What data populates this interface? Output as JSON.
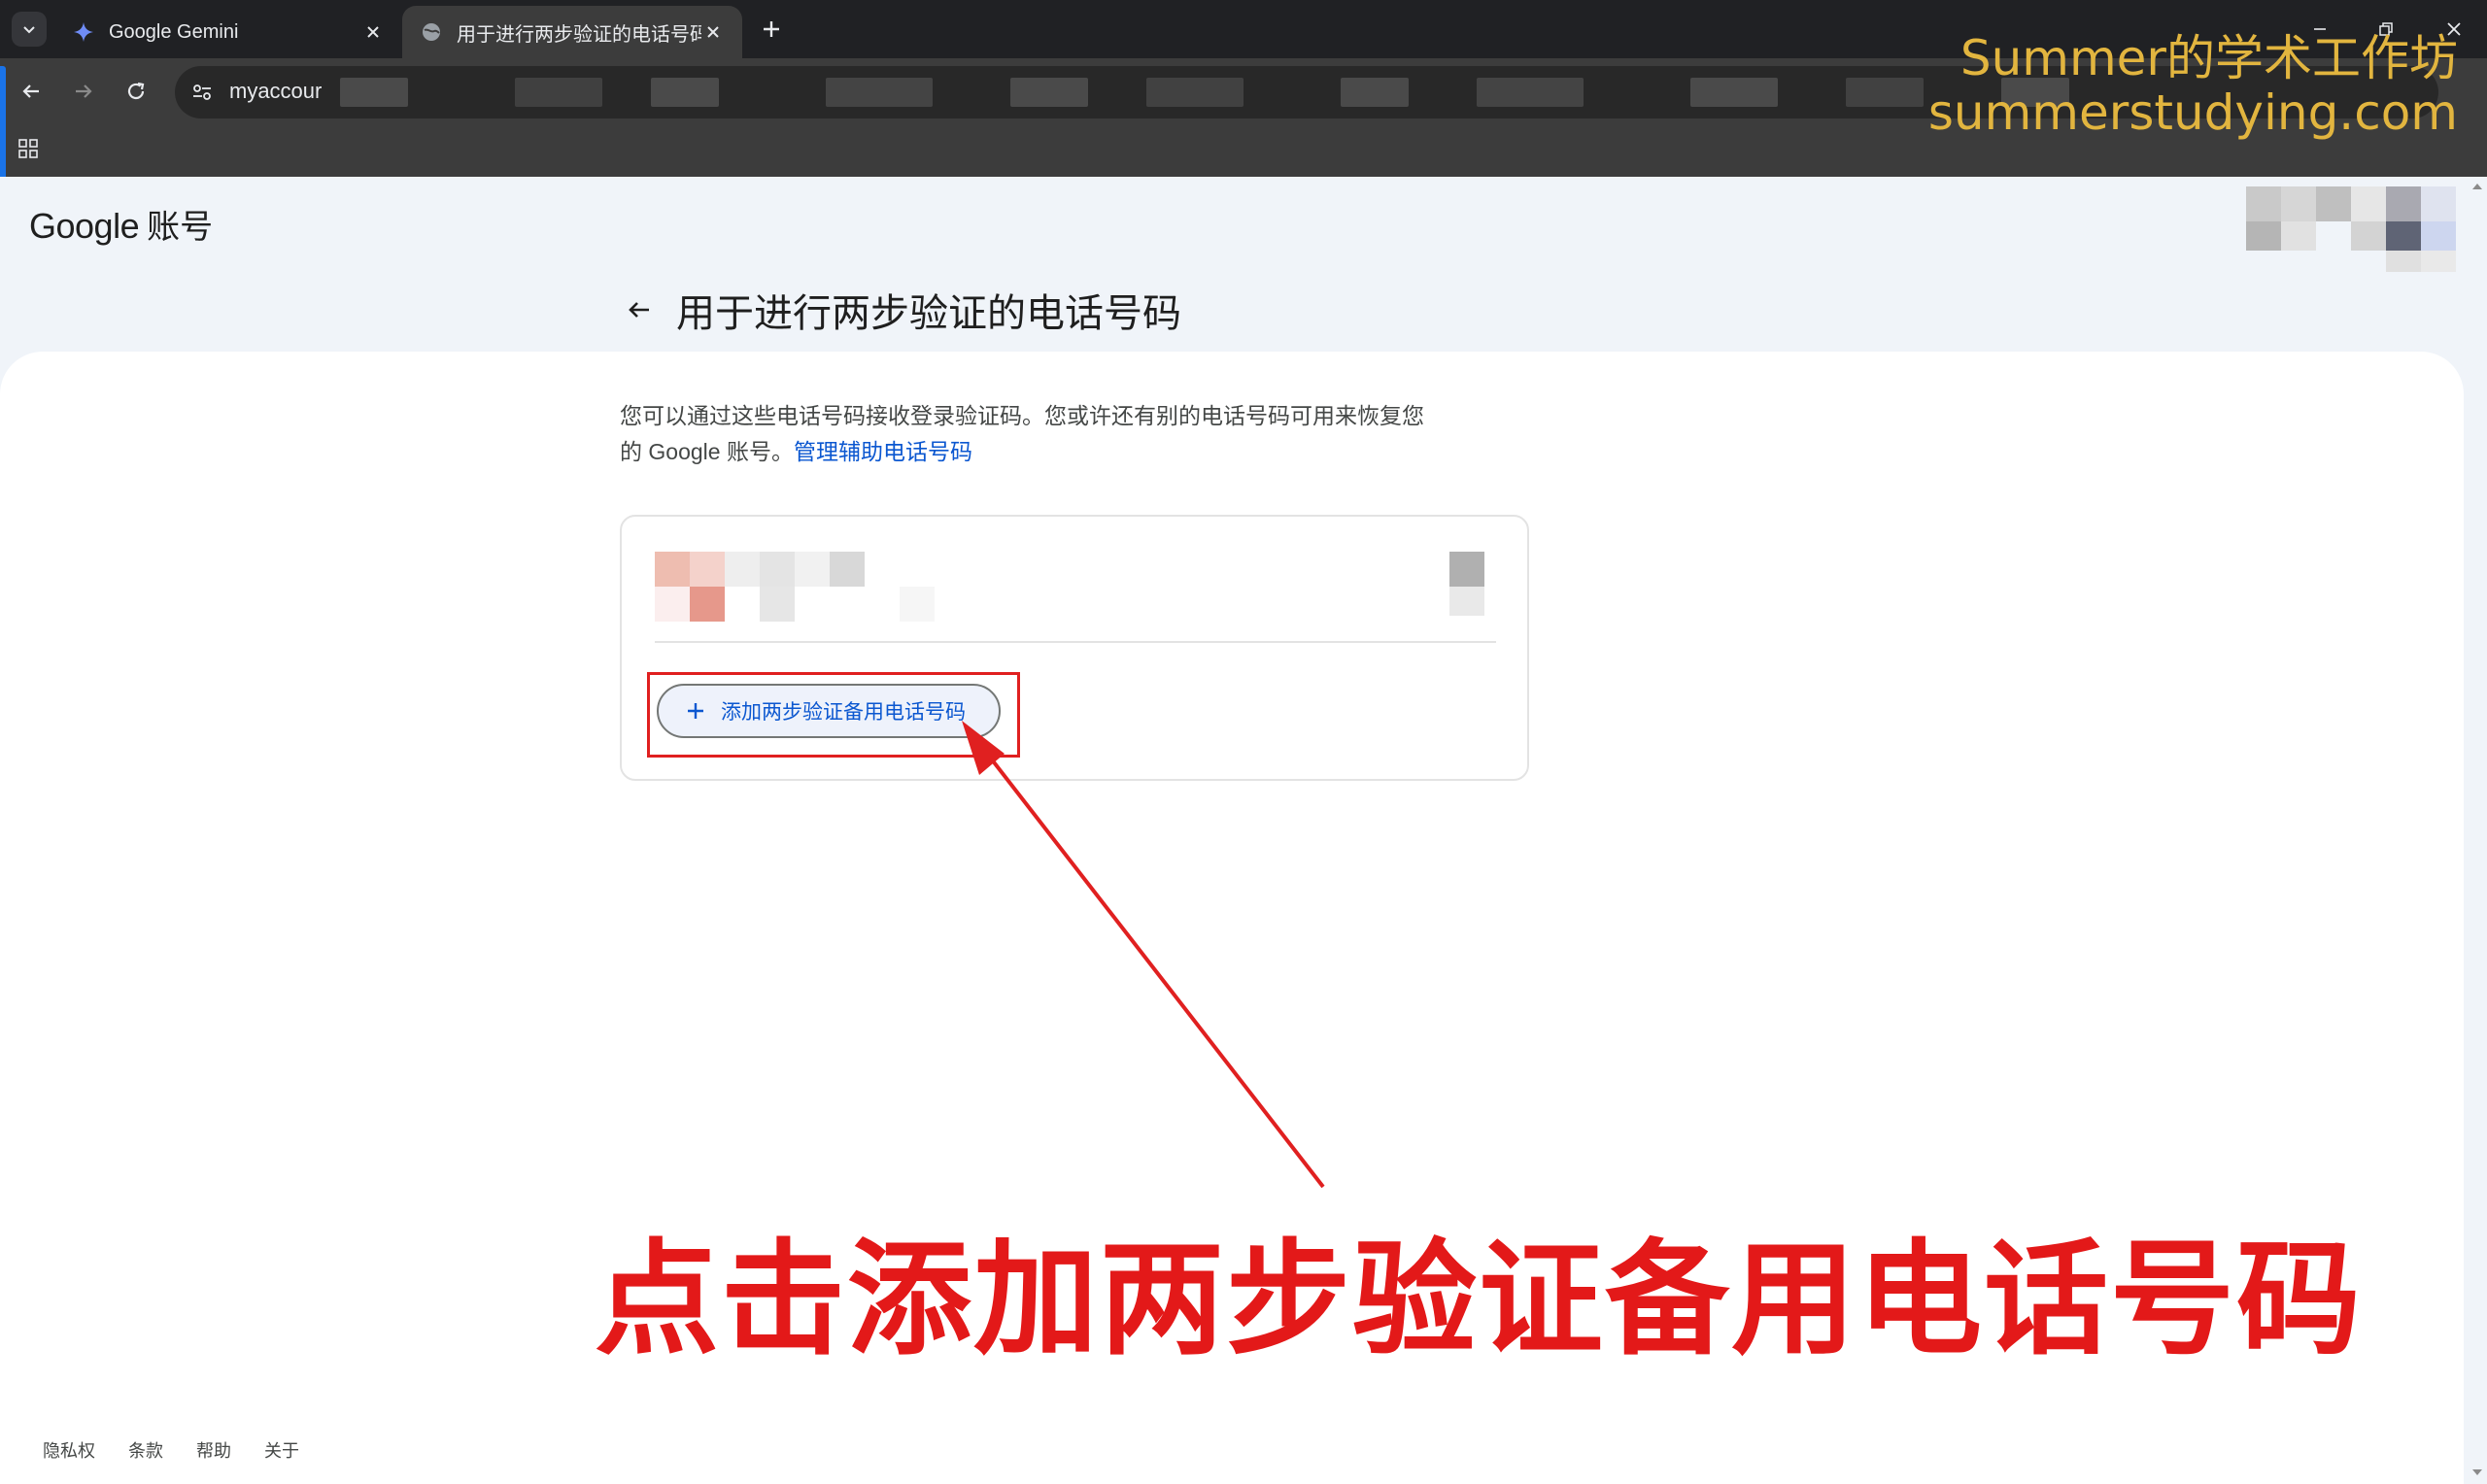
{
  "browser": {
    "tabs": [
      {
        "title": "Google Gemini",
        "icon": "gemini-icon",
        "active": false
      },
      {
        "title": "用于进行两步验证的电话号码",
        "icon": "globe-icon",
        "active": true
      }
    ],
    "url": "myaccour"
  },
  "watermark": {
    "line1": "Summer的学术工作坊",
    "line2": "summerstudying.com"
  },
  "page": {
    "brand_google": "Google",
    "brand_suffix": "账号",
    "title": "用于进行两步验证的电话号码",
    "description_part1": "您可以通过这些电话号码接收登录验证码。您或许还有别的电话号码可用来恢复您的 Google 账号。",
    "description_link": "管理辅助电话号码",
    "add_button_label": "添加两步验证备用电话号码"
  },
  "annotation": {
    "text": "点击添加两步验证备用电话号码",
    "color": "#e31919"
  },
  "footer": {
    "links": [
      "隐私权",
      "条款",
      "帮助",
      "关于"
    ]
  },
  "colors": {
    "link": "#0b57d0",
    "highlight": "#e02020",
    "watermark": "#e2b53f"
  }
}
